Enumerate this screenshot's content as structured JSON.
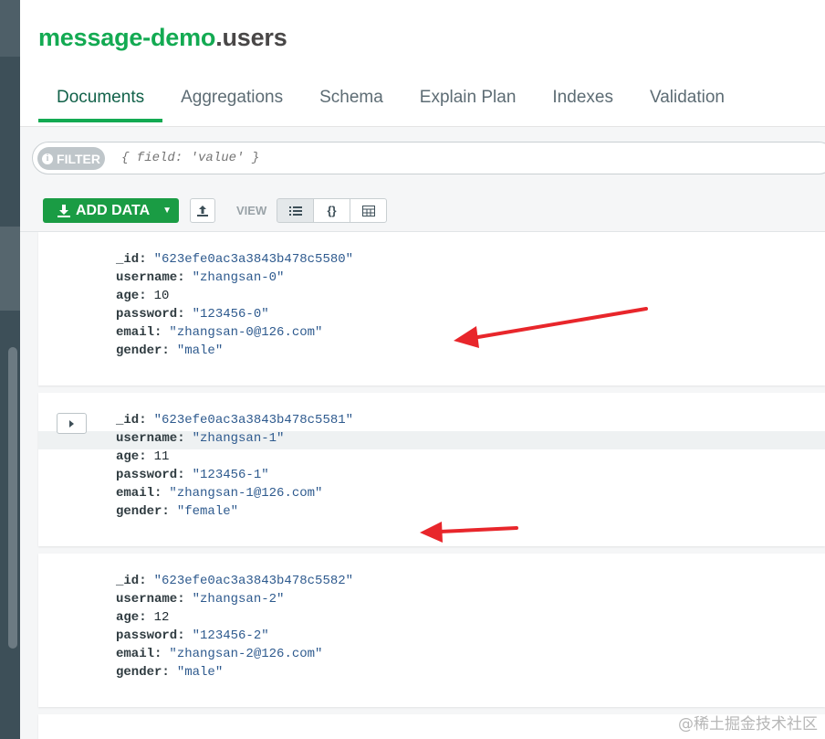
{
  "header": {
    "db_name": "message-demo",
    "collection_name": ".users"
  },
  "tabs": [
    {
      "label": "Documents",
      "active": true
    },
    {
      "label": "Aggregations",
      "active": false
    },
    {
      "label": "Schema",
      "active": false
    },
    {
      "label": "Explain Plan",
      "active": false
    },
    {
      "label": "Indexes",
      "active": false
    },
    {
      "label": "Validation",
      "active": false
    }
  ],
  "filter": {
    "button_label": "FILTER",
    "placeholder": "{ field: 'value' }"
  },
  "toolbar": {
    "add_data_label": "ADD DATA",
    "view_label": "VIEW",
    "view_json_label": "{}"
  },
  "documents": [
    {
      "id": "\"623efe0ac3a3843b478c5580\"",
      "username": "\"zhangsan-0\"",
      "age": "10",
      "password": "\"123456-0\"",
      "email": "\"zhangsan-0@126.com\"",
      "gender": "\"male\""
    },
    {
      "id": "\"623efe0ac3a3843b478c5581\"",
      "username": "\"zhangsan-1\"",
      "age": "11",
      "password": "\"123456-1\"",
      "email": "\"zhangsan-1@126.com\"",
      "gender": "\"female\""
    },
    {
      "id": "\"623efe0ac3a3843b478c5582\"",
      "username": "\"zhangsan-2\"",
      "age": "12",
      "password": "\"123456-2\"",
      "email": "\"zhangsan-2@126.com\"",
      "gender": "\"male\""
    }
  ],
  "field_keys": {
    "id": "_id:",
    "username": "username:",
    "age": "age:",
    "password": "password:",
    "email": "email:",
    "gender": "gender:"
  },
  "watermark": "@稀土掘金技术社区",
  "colors": {
    "accent_green": "#13aa52",
    "annotation_arrow": "#e8262b",
    "sidebar": "#3d4f58"
  }
}
